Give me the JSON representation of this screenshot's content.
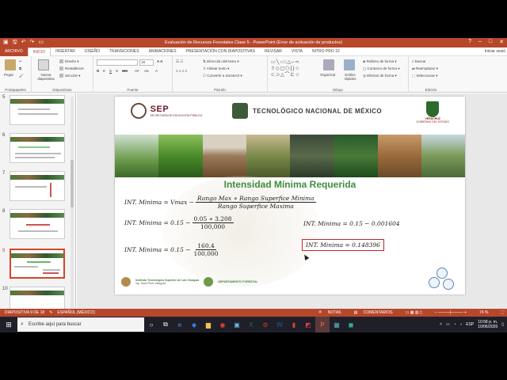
{
  "window": {
    "title": "Evaluación de Recursos Forestales Clase 5 - PowerPoint (Error de activación de productos)"
  },
  "tabs": [
    "ARCHIVO",
    "INICIO",
    "INSERTAR",
    "DISEÑO",
    "TRANSICIONES",
    "ANIMACIONES",
    "PRESENTACIÓN CON DIAPOSITIVAS",
    "REVISAR",
    "VISTA",
    "NITRO PRO 10"
  ],
  "active_tab": "INICIO",
  "login_text": "Iniciar sesió",
  "ribbon": {
    "paste": "Pegar",
    "new_slide": "Nueva diapositiva",
    "layout": "Diseño",
    "reset": "Restablecer",
    "section": "Sección",
    "font_size": "18",
    "text_direction": "Dirección del texto",
    "align_text": "Alinear texto",
    "smartart": "Convertir a SmartArt",
    "arrange": "Organizar",
    "quick_styles": "Estilos rápidos",
    "shape_fill": "Relleno de forma",
    "shape_outline": "Contorno de forma",
    "shape_effects": "Efectos de forma",
    "find": "Buscar",
    "replace": "Reemplazar",
    "select": "Seleccionar",
    "groups": {
      "clipboard": "Portapapeles",
      "slides": "Diapositivas",
      "font": "Fuente",
      "paragraph": "Párrafo",
      "drawing": "Dibujo",
      "editing": "Edición"
    }
  },
  "thumbnails": [
    {
      "num": "5"
    },
    {
      "num": "6"
    },
    {
      "num": "7"
    },
    {
      "num": "8"
    },
    {
      "num": "9",
      "selected": true
    },
    {
      "num": "10"
    }
  ],
  "slide": {
    "sep": "SEP",
    "sep_sub": "SECRETARÍA DE EDUCACIÓN PÚBLICA",
    "tecnm": "TECNOLÓGICO NACIONAL DE MÉXICO",
    "veracruz": "VERACRUZ",
    "veracruz_sub": "GOBIERNO DEL ESTADO",
    "title": "Intensidad Mínima Requerida",
    "eq1_lhs": "INT. Minima = Vmax −",
    "eq1_num": "Rango Max ∗ Rango Superfice Minima",
    "eq1_den": "Rango Superfice Maxima",
    "eq2_lhs": "INT. Minima = 0.15 −",
    "eq2_num": "0.05 ∗ 3.208",
    "eq2_den": "100,000",
    "eq3_lhs": "INT. Minima = 0.15 −",
    "eq3_num": "160.4",
    "eq3_den": "100,000",
    "eq4": "INT. Minima = 0.15 − 0.001604",
    "eq5": "INT. Minima = 0.148396",
    "footer_inst": "Instituto Tecnológico Superior de Las Choapas",
    "footer_inst_sub": "Ing. Jesús Pérez Zaragoza",
    "footer_dept": "DEPARTAMENTO FORESTAL"
  },
  "status": {
    "slide_info": "DIAPOSITIVA 9 DE 18",
    "language": "ESPAÑOL (MÉXICO)",
    "notes": "NOTAS",
    "comments": "COMENTARIOS",
    "zoom": "74 %"
  },
  "taskbar": {
    "search_placeholder": "Escribe aquí para buscar",
    "lang": "ESP",
    "time": "10:58 p. m.",
    "date": "10/06/2020"
  }
}
